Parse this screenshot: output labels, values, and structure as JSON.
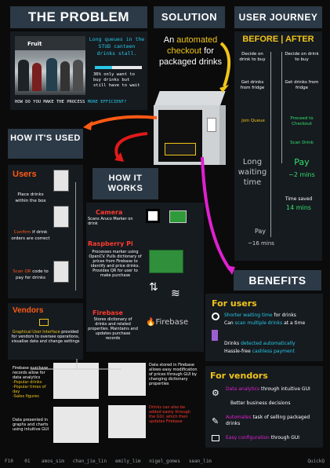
{
  "headers": {
    "problem": "THE PROBLEM",
    "solution": "SOLUTION",
    "journey": "USER JOURNEY",
    "how_used": "HOW IT'S USED",
    "how_works": "HOW IT WORKS",
    "benefits": "BENEFITS"
  },
  "problem": {
    "photo_label": "Fruit",
    "long_queues": "Long queues in the STUD canteen drinks stall.",
    "stat": "36% only want to buy drinks but still have to wait",
    "question_prefix": "HOW DO YOU MAKE THE PROCESS ",
    "question_highlight": "MORE EFFICIENT?"
  },
  "solution": {
    "line1": "An ",
    "automated": "automated",
    "checkout": "checkout",
    "line2": " for packaged drinks"
  },
  "journey": {
    "title": "BEFORE | AFTER",
    "before_decide": "Decide on drink to buy",
    "after_decide": "Decide on drink to buy",
    "before_get": "Get drinks from fridge",
    "after_get": "Get drinks from fridge",
    "before_join": "Join Queue",
    "after_proceed": "Proceed to Checkout",
    "after_scan": "Scan Drink",
    "before_long": "Long waiting time",
    "after_pay": "Pay",
    "after_time": "~2 mins",
    "time_saved": "Time saved",
    "time_saved_value": "14 mins",
    "before_pay": "Pay",
    "before_time": "~16 mins"
  },
  "used": {
    "users_title": "Users",
    "place": "Place drinks within the box",
    "confirm_hl": "Confirm",
    "confirm": " if drink orders are correct",
    "scan_hl": "Scan QR",
    "scan": " code to pay for drinks",
    "vendors_title": "Vendors",
    "gui_hl": "Graphical User Interface",
    "gui": " provided for vendors to oversee operations, visualise data and change settings"
  },
  "works": {
    "camera_title": "Camera",
    "camera_text": "Scans Aruco Marker on drink",
    "pi_title": "Raspberry Pi",
    "pi_text": "Processes marker using OpenCV. Pulls dictionary of prices from Firebase to identify and price drinks. Provides QR for user to make purchase",
    "firebase_title": "Firebase",
    "firebase_text": "Stores dictionary of drinks and related properties. Maintains and updates purchase records",
    "firebase_logo": "Firebase",
    "vendor_records": "Firebase purchase records allow for data analytics",
    "popular_drinks": "-Popular drinks",
    "popular_times": "-Popular times of day",
    "sales_figures": "-Sales figures",
    "data_presented": "Data presented in graphs and charts using intuitive GUI",
    "data_stored": "Data stored in Firebase allows easy modification of prices through GUI by changing dictionary properties",
    "drinks_added": "Drinks can also be added easily through the GUI, which then updates Firebase"
  },
  "benefits": {
    "users_title": "For users",
    "b1_hl": "Shorter waiting time",
    "b1": " for drinks",
    "b2_pre": "Can ",
    "b2_hl": "scan multiple drinks",
    "b2": " at a time",
    "b3_pre": "Drinks ",
    "b3_hl": "detected automatically",
    "b4_pre": "Hassle-free ",
    "b4_hl": "cashless payment",
    "vendors_title": "For vendors",
    "v1_hl": "Data analytics",
    "v1": " through intuitive GUI",
    "v1b": "Better business decisions",
    "v2_hl": "Automates",
    "v2": " task of selling packaged drinks",
    "v3_hl": "Easy configuration",
    "v3": " through GUI"
  },
  "footer": {
    "code": "F10",
    "team": "01",
    "m1": "amos_sim",
    "m2": "chan_jie_lin",
    "m3": "emily_lim",
    "m4": "nigel_gomes",
    "m5": "sean_lim",
    "brand": "QuickQ"
  }
}
